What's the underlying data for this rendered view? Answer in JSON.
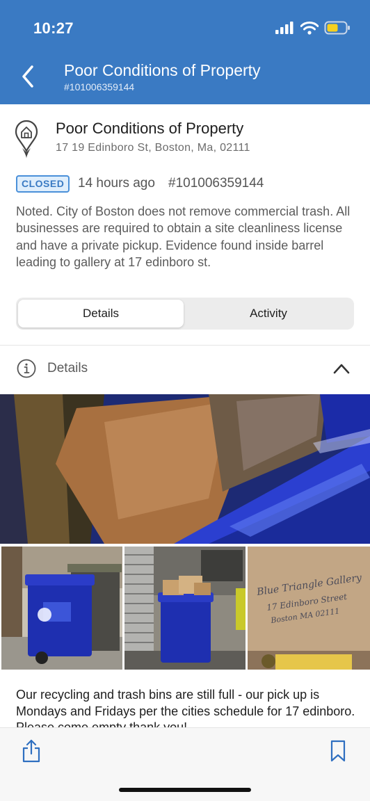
{
  "status_bar": {
    "time": "10:27"
  },
  "header": {
    "title": "Poor Conditions of Property",
    "subtitle": "#101006359144"
  },
  "summary": {
    "title": "Poor Conditions of Property",
    "address": "17 19 Edinboro St, Boston, Ma, 02111",
    "status_badge": "CLOSED",
    "time_ago": "14 hours ago",
    "case_id": "#101006359144",
    "description": "Noted. City of Boston does not remove commercial trash. All businesses are required to obtain a site cleanliness license and have a private pickup. Evidence found inside barrel leading to gallery at 17 edinboro st."
  },
  "tabs": [
    {
      "label": "Details",
      "selected": true
    },
    {
      "label": "Activity",
      "selected": false
    }
  ],
  "details_section": {
    "label": "Details",
    "expanded": true
  },
  "photos": {
    "handwritten_note": "Blue Triangle Gallery 17 Edinboro Street Boston MA 02111"
  },
  "comment": "Our recycling and trash bins are still full - our pick up is Mondays and Fridays per the cities schedule for 17 edinboro. Please come empty thank you!",
  "icons": {
    "back": "chevron-left-icon",
    "location": "map-pin-house-icon",
    "info": "info-circle-icon",
    "collapse": "chevron-up-icon",
    "share": "share-icon",
    "bookmark": "bookmark-icon"
  },
  "colors": {
    "header_bg": "#3a7ac3",
    "badge_border": "#4a90d9",
    "badge_bg": "#dfeefc",
    "accent": "#3a7ac3"
  }
}
